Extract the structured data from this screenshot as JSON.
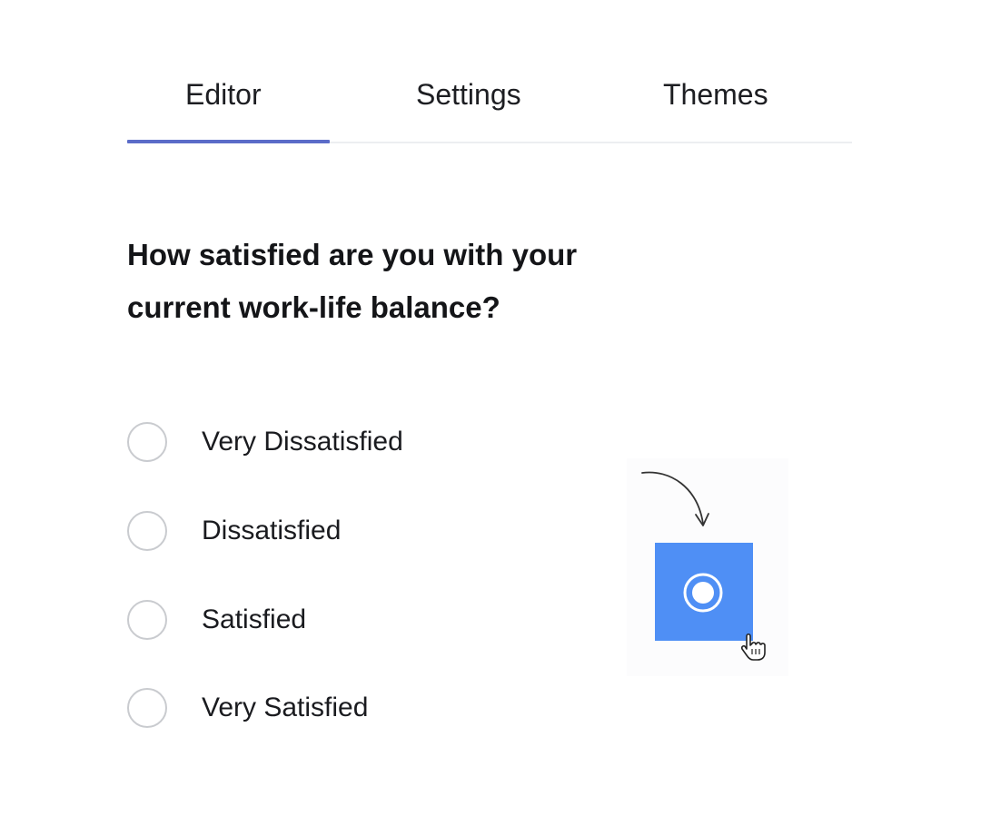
{
  "tabs": [
    {
      "label": "Editor",
      "active": true
    },
    {
      "label": "Settings",
      "active": false
    },
    {
      "label": "Themes",
      "active": false
    }
  ],
  "question": {
    "line1": "How satisfied are you with your",
    "line2": "current work-life balance?"
  },
  "options": [
    {
      "label": "Very Dissatisfied",
      "selected": false
    },
    {
      "label": "Dissatisfied",
      "selected": false
    },
    {
      "label": "Satisfied",
      "selected": false
    },
    {
      "label": "Very Satisfied",
      "selected": false
    }
  ],
  "colors": {
    "accent": "#5b6cc8",
    "radio_block": "#4f8ff5",
    "radio_border": "#c9cbcf"
  },
  "icons": {
    "illustration": "radio-block-icon",
    "arrow": "curved-arrow-icon",
    "pointer": "hand-pointer-icon"
  }
}
